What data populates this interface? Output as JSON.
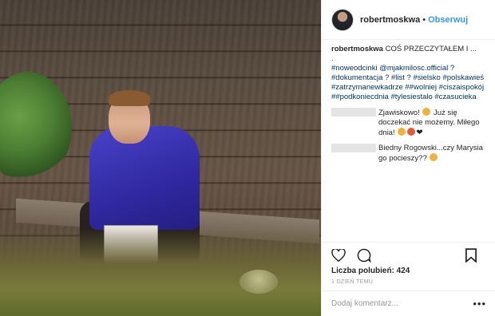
{
  "header": {
    "username": "robertmoskwa",
    "separator": "•",
    "follow_label": "Obserwuj"
  },
  "caption": {
    "username": "robertmoskwa",
    "text": "COŚ PRZECZYTAŁEM I ...",
    "dot": ".",
    "line1": "#noweodcinki @mjakmilosc.official ?",
    "line2": "#dokumentacja ? #list ? #sielsko #polskawieś",
    "line3": "#zatrzymanewkadrze ##wolniej #ciszaispokój",
    "line4": "##podkoniecdnia #tylesiestalo #czasucieka"
  },
  "comments": [
    {
      "text1": "Zjawiskowo!",
      "text2": "Już się doczekać nie możemy. Miłego dnia!"
    },
    {
      "text1": "Biedny Rogowski...czy Marysia go pocieszy??"
    }
  ],
  "likes": "Liczba polubień: 424",
  "time": "1 DZIEŃ TEMU",
  "add_comment_placeholder": "Dodaj komentarz...",
  "more": "•••",
  "icons": {
    "like": "heart-icon",
    "comment": "comment-icon",
    "save": "bookmark-icon"
  },
  "colors": {
    "link": "#3897f0",
    "hashtag": "#003569"
  }
}
